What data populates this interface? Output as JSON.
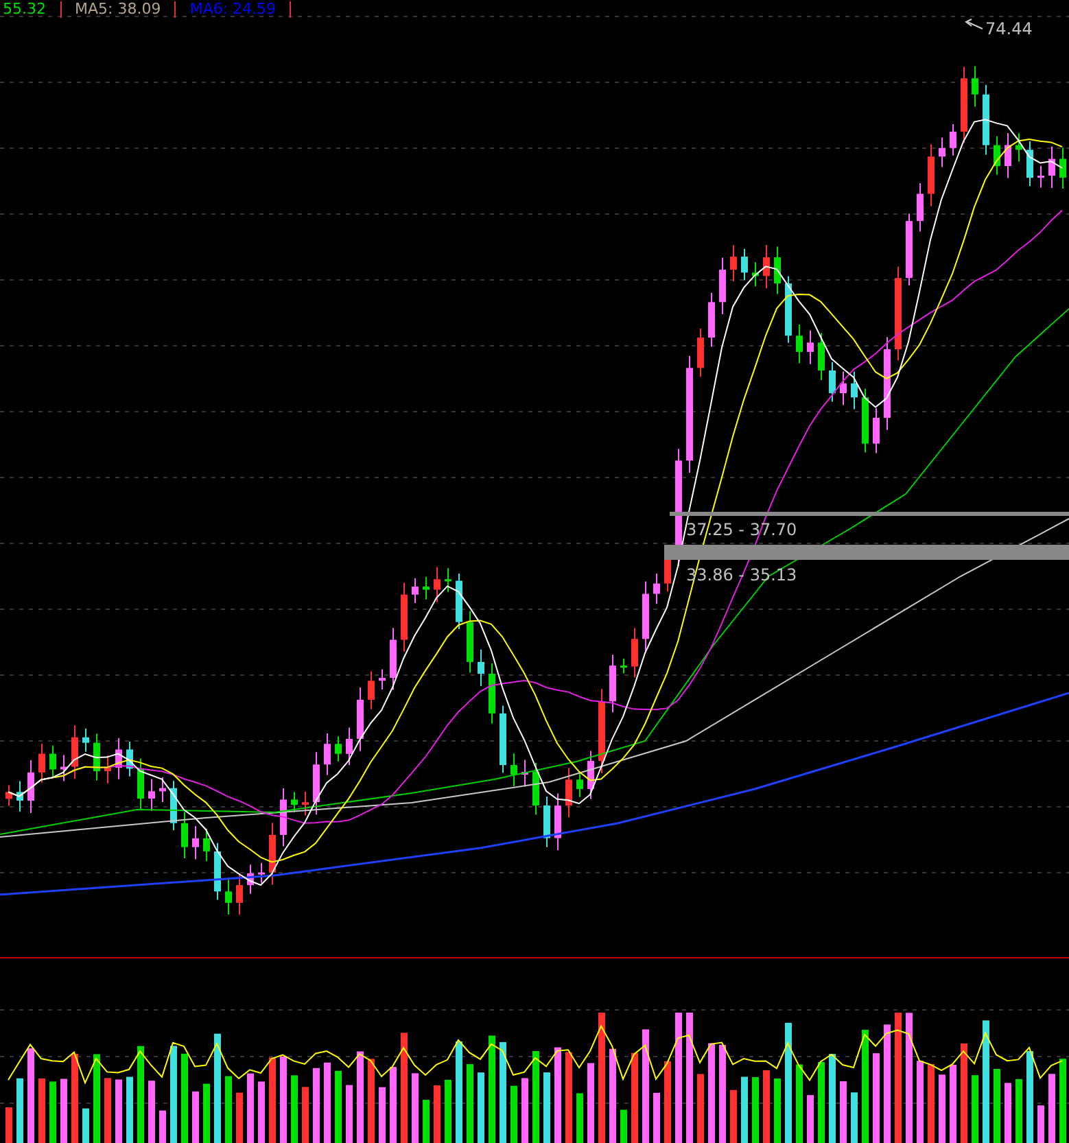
{
  "indicator_bar": [
    {
      "label": "55.32",
      "color": "#00e000"
    },
    {
      "label": "MA5: 38.09",
      "color": "#b4a48c"
    },
    {
      "label": "MA6: 24.59",
      "color": "#0000ff"
    }
  ],
  "peak_label": "74.44",
  "price_zones": [
    {
      "kind": "thin",
      "label": "37.25 - 37.70"
    },
    {
      "kind": "thick",
      "label": "33.86 - 35.13"
    }
  ]
}
